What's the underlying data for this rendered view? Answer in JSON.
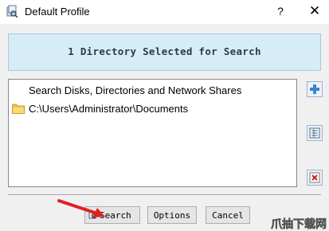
{
  "window": {
    "title": "Default Profile",
    "help_glyph": "?",
    "close_glyph": "✕"
  },
  "banner": {
    "text": "1 Directory Selected for Search"
  },
  "list": {
    "header": "Search Disks, Directories and Network Shares",
    "items": [
      {
        "icon": "folder-icon",
        "path": "C:\\Users\\Administrator\\Documents"
      }
    ]
  },
  "side_buttons": [
    {
      "icon": "add-icon"
    },
    {
      "icon": "properties-icon"
    },
    {
      "icon": "remove-icon"
    }
  ],
  "buttons": {
    "search": "Search",
    "options": "Options",
    "cancel": "Cancel"
  },
  "watermark": {
    "text": "爪抽下载网"
  },
  "colors": {
    "banner_bg": "#d6edf7",
    "annotation_arrow": "#e02020",
    "folder": "#f5c451"
  }
}
